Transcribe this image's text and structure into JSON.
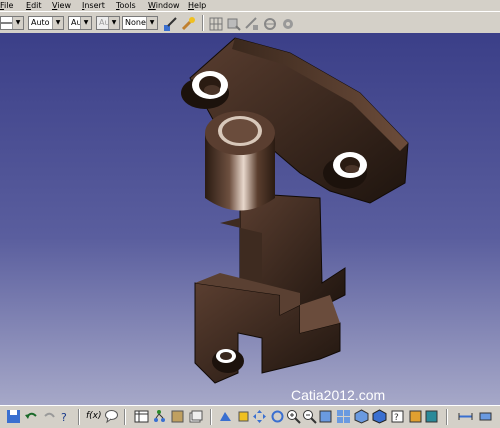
{
  "menu": {
    "items": [
      "File",
      "Edit",
      "View",
      "Insert",
      "Tools",
      "Window",
      "Help"
    ],
    "mnemonics": [
      "F",
      "E",
      "V",
      "I",
      "T",
      "W",
      "H"
    ]
  },
  "toolbar": {
    "combo_linetype": "",
    "combo_weight": "Auto",
    "combo_color": "Aut",
    "combo_layer": "Aut",
    "combo_render": "None"
  },
  "viewport": {
    "watermark": "Catia2012.com",
    "background_top": "#3b3f88",
    "background_bottom": "#a6a8c8",
    "part_color": "#4a3324"
  },
  "bottom_toolbar": {
    "formula_label": "f(x)"
  }
}
